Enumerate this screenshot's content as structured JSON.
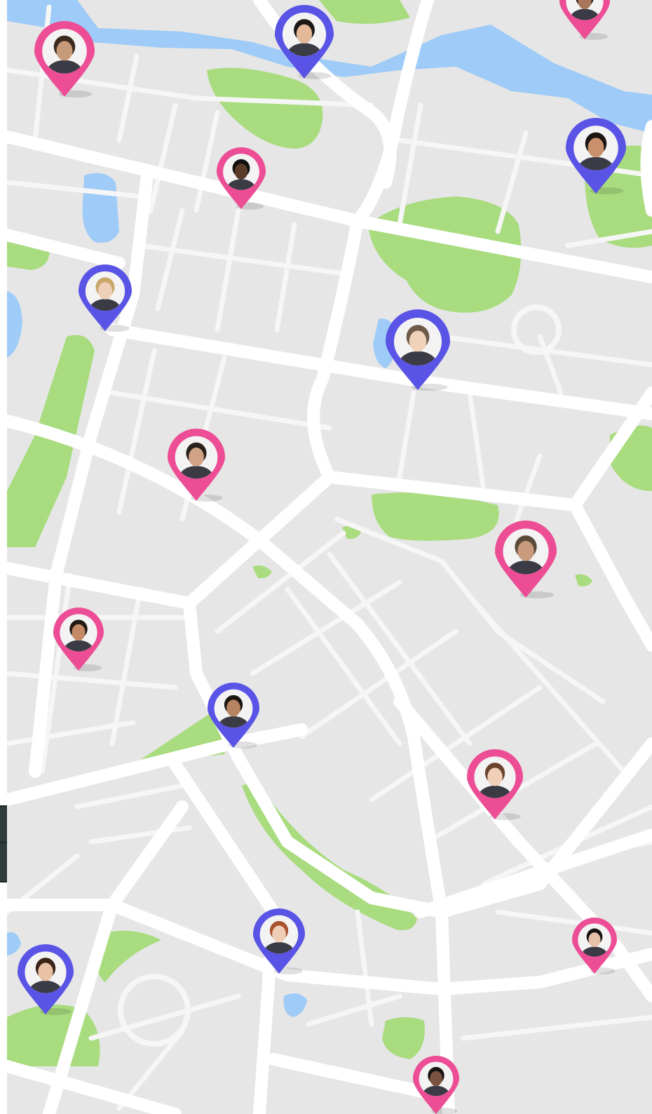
{
  "map": {
    "colors": {
      "land": "#e6e6e6",
      "road": "#ffffff",
      "park": "#a9dc7f",
      "water": "#9ecbf7"
    }
  },
  "pins": [
    {
      "id": "pin-1",
      "color": "pink",
      "avatar": "user-avatar-man-curly-hair"
    },
    {
      "id": "pin-2",
      "color": "blue",
      "avatar": "user-avatar-woman-dark-hair"
    },
    {
      "id": "pin-3",
      "color": "pink",
      "avatar": "user-avatar-man-beard"
    },
    {
      "id": "pin-4",
      "color": "blue",
      "avatar": "user-avatar-man-dark-beard"
    },
    {
      "id": "pin-5",
      "color": "pink",
      "avatar": "user-avatar-man-glasses"
    },
    {
      "id": "pin-6",
      "color": "blue",
      "avatar": "user-avatar-woman-blonde"
    },
    {
      "id": "pin-7",
      "color": "blue",
      "avatar": "user-avatar-man-smiling"
    },
    {
      "id": "pin-8",
      "color": "pink",
      "avatar": "user-avatar-man-long-hair"
    },
    {
      "id": "pin-9",
      "color": "pink",
      "avatar": "user-avatar-man-outdoors"
    },
    {
      "id": "pin-10",
      "color": "pink",
      "avatar": "user-avatar-man-laughing"
    },
    {
      "id": "pin-11",
      "color": "blue",
      "avatar": "user-avatar-man-short-hair"
    },
    {
      "id": "pin-12",
      "color": "pink",
      "avatar": "user-avatar-woman-smiling"
    },
    {
      "id": "pin-13",
      "color": "blue",
      "avatar": "user-avatar-woman-red-hair"
    },
    {
      "id": "pin-14",
      "color": "pink",
      "avatar": "user-avatar-woman-long-dark-hair"
    },
    {
      "id": "pin-15",
      "color": "blue",
      "avatar": "user-avatar-woman-red-top"
    },
    {
      "id": "pin-16",
      "color": "pink",
      "avatar": "user-avatar-man-beard-bottom"
    }
  ],
  "pin_colors": {
    "pink": "#ec4d95",
    "blue": "#5a54e6"
  }
}
